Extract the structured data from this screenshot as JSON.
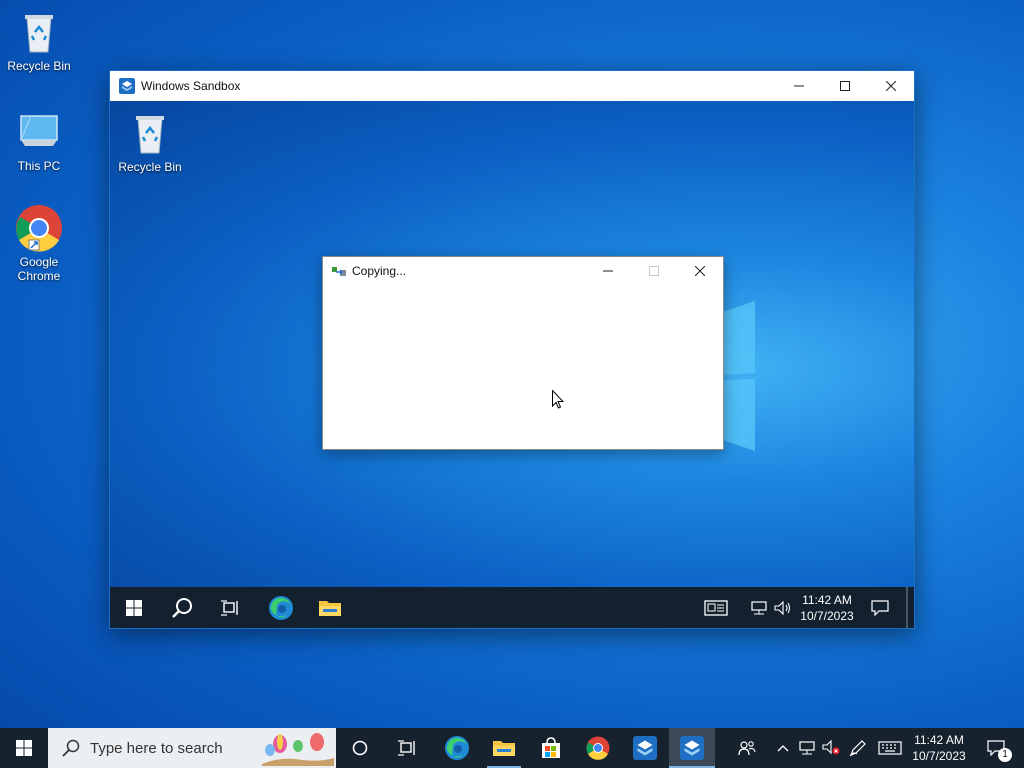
{
  "desktop": {
    "icons": [
      {
        "label": "Recycle Bin"
      },
      {
        "label": "This PC"
      },
      {
        "label": "Google Chrome"
      }
    ]
  },
  "sandbox": {
    "title": "Windows Sandbox",
    "desktop_icon": {
      "label": "Recycle Bin"
    },
    "copy_dialog": {
      "title": "Copying..."
    },
    "taskbar": {
      "time": "11:42 AM",
      "date": "10/7/2023"
    }
  },
  "taskbar": {
    "search_placeholder": "Type here to search",
    "time": "11:42 AM",
    "date": "10/7/2023",
    "notification_count": "1"
  },
  "colors": {
    "accent": "#0078d7",
    "taskbar": "#16232f",
    "sandbox_taskbar": "#13212f"
  }
}
